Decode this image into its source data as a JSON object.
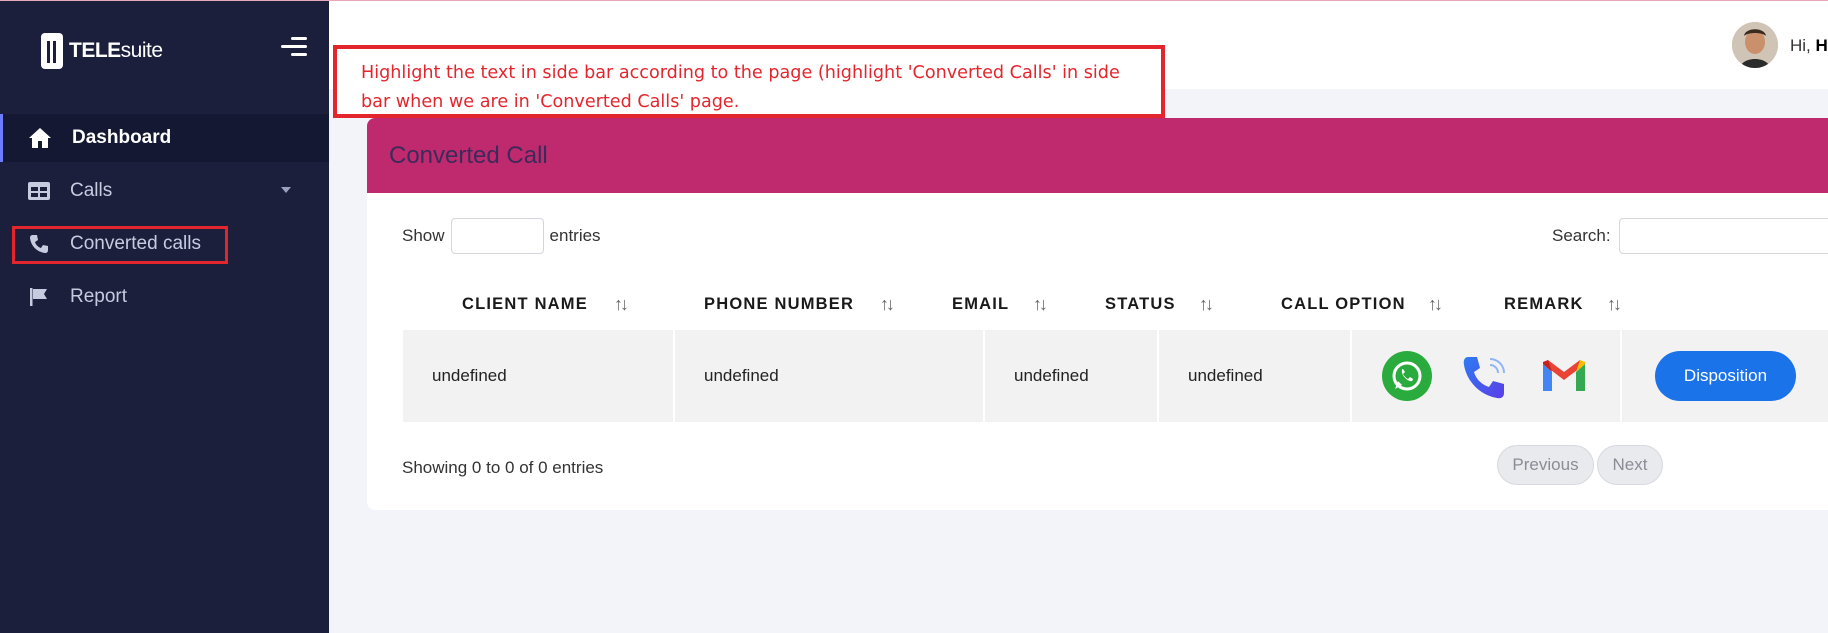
{
  "brand": {
    "name_bold": "TELE",
    "name_light": "suite"
  },
  "sidebar": {
    "items": [
      {
        "label": "Dashboard",
        "icon": "home-icon",
        "active": true
      },
      {
        "label": "Calls",
        "icon": "table-icon",
        "has_dropdown": true
      },
      {
        "label": "Converted calls",
        "icon": "phone-icon",
        "highlighted": true
      },
      {
        "label": "Report",
        "icon": "flag-icon"
      }
    ]
  },
  "header": {
    "greeting_prefix": "Hi,",
    "greeting_name": "H"
  },
  "annotation": {
    "text": "Highlight the text in side bar according to the page (highlight 'Converted Calls' in side bar when we are in 'Converted Calls' page.",
    "color": "#e3262e"
  },
  "card": {
    "title": "Converted Call",
    "header_color": "#bf2a6e",
    "show_label": "Show",
    "entries_label": "entries",
    "search_label": "Search:"
  },
  "table": {
    "columns": [
      "CLIENT NAME",
      "PHONE NUMBER",
      "EMAIL",
      "STATUS",
      "CALL OPTION",
      "REMARK"
    ],
    "rows": [
      {
        "client_name": "undefined",
        "phone_number": "undefined",
        "email": "undefined",
        "status": "undefined",
        "call_options": [
          "whatsapp-icon",
          "phone-call-icon",
          "gmail-icon"
        ],
        "remark_button": "Disposition"
      }
    ]
  },
  "footer": {
    "info": "Showing 0 to 0 of 0 entries",
    "previous": "Previous",
    "next": "Next"
  },
  "colors": {
    "sidebar_bg": "#1b1f3b",
    "primary_button": "#1a73e8"
  }
}
